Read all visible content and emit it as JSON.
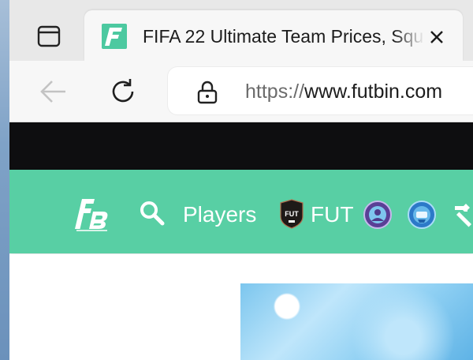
{
  "browser": {
    "tab": {
      "title": "FIFA 22 Ultimate Team Prices, Squ"
    },
    "address_bar": {
      "url_scheme": "https://",
      "url_host": "www.futbin.com"
    }
  },
  "site_nav": {
    "players_label": "Players",
    "fut_label": "FUT",
    "fut_badge_text": "FUT",
    "brand_color": "#58cfa4"
  },
  "icons": {
    "tab_actions": "tab-actions-icon",
    "favicon": "futbin-favicon",
    "close": "close-icon",
    "back": "back-arrow-icon",
    "reload": "reload-icon",
    "lock": "lock-icon",
    "logo": "futbin-logo",
    "search": "search-icon",
    "fut": "fut-badge-icon",
    "sbc": "sbc-icon",
    "draft": "draft-icon",
    "tools": "hammer-icon"
  }
}
